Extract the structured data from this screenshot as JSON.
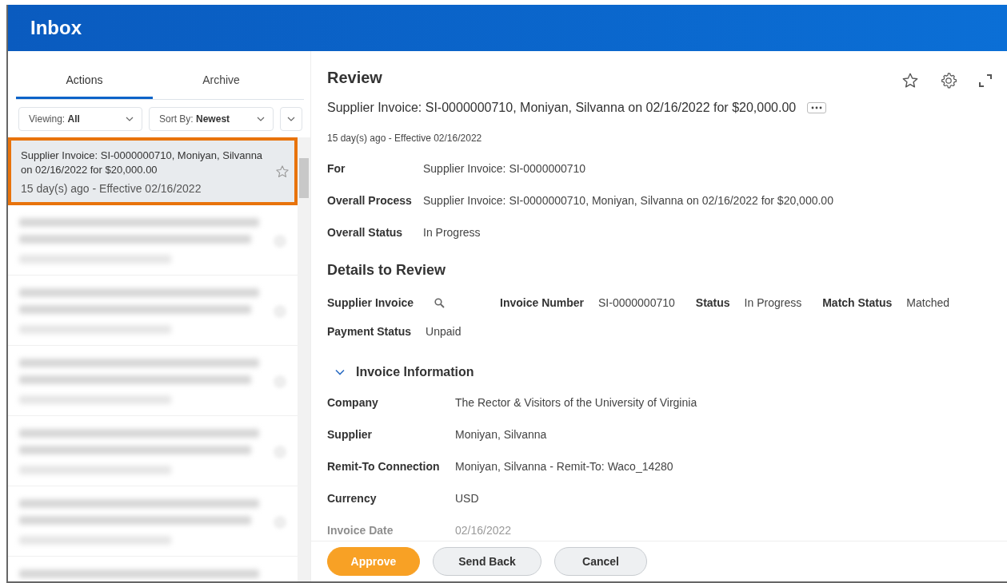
{
  "header": {
    "title": "Inbox"
  },
  "tabs": [
    {
      "label": "Actions",
      "selected": true
    },
    {
      "label": "Archive",
      "selected": false
    }
  ],
  "filters": [
    {
      "label": "Viewing:",
      "value": "All"
    },
    {
      "label": "Sort By:",
      "value": "Newest"
    }
  ],
  "inbox_items": [
    {
      "kind": "task",
      "title": "Supplier Invoice: SI-0000000710, Moniyan, Silvanna on 02/16/2022 for $20,000.00",
      "meta": "15 day(s) ago - Effective 02/16/2022",
      "selected": true,
      "starred": false
    },
    {
      "kind": "redacted"
    },
    {
      "kind": "redacted"
    },
    {
      "kind": "redacted"
    },
    {
      "kind": "redacted"
    },
    {
      "kind": "redacted"
    },
    {
      "kind": "redacted"
    }
  ],
  "review": {
    "title": "Review",
    "subtitle": "Supplier Invoice: SI-0000000710, Moniyan, Silvanna on 02/16/2022 for $20,000.00",
    "meta": "15 day(s) ago -  Effective 02/16/2022",
    "fields": [
      {
        "label": "For",
        "value": "Supplier Invoice: SI-0000000710"
      },
      {
        "label": "Overall Process",
        "value": "Supplier Invoice: SI-0000000710, Moniyan, Silvanna on 02/16/2022 for $20,000.00"
      },
      {
        "label": "Overall Status",
        "value": "In Progress"
      }
    ],
    "details": {
      "title": "Details to Review",
      "items": [
        {
          "kind": "search",
          "label": "Supplier Invoice"
        },
        {
          "kind": "text",
          "label": "Invoice Number",
          "value": "SI-0000000710"
        },
        {
          "kind": "text",
          "label": "Status",
          "value": "In Progress"
        },
        {
          "kind": "text",
          "label": "Match Status",
          "value": "Matched"
        },
        {
          "kind": "text",
          "label": "Payment Status",
          "value": "Unpaid"
        }
      ]
    },
    "invoice_information": {
      "title": "Invoice Information",
      "expanded": true,
      "fields": [
        {
          "label": "Company",
          "value": "The Rector & Visitors of the University of Virginia",
          "faded": false
        },
        {
          "label": "Supplier",
          "value": "Moniyan, Silvanna",
          "faded": false
        },
        {
          "label": "Remit-To Connection",
          "value": "Moniyan, Silvanna - Remit-To: Waco_14280",
          "faded": false
        },
        {
          "label": "Currency",
          "value": "USD",
          "faded": false
        },
        {
          "label": "Invoice Date",
          "value": "02/16/2022",
          "faded": true
        }
      ]
    }
  },
  "actions": [
    {
      "label": "Approve",
      "kind": "primary"
    },
    {
      "label": "Send Back",
      "kind": "secondary"
    },
    {
      "label": "Cancel",
      "kind": "secondary"
    }
  ]
}
